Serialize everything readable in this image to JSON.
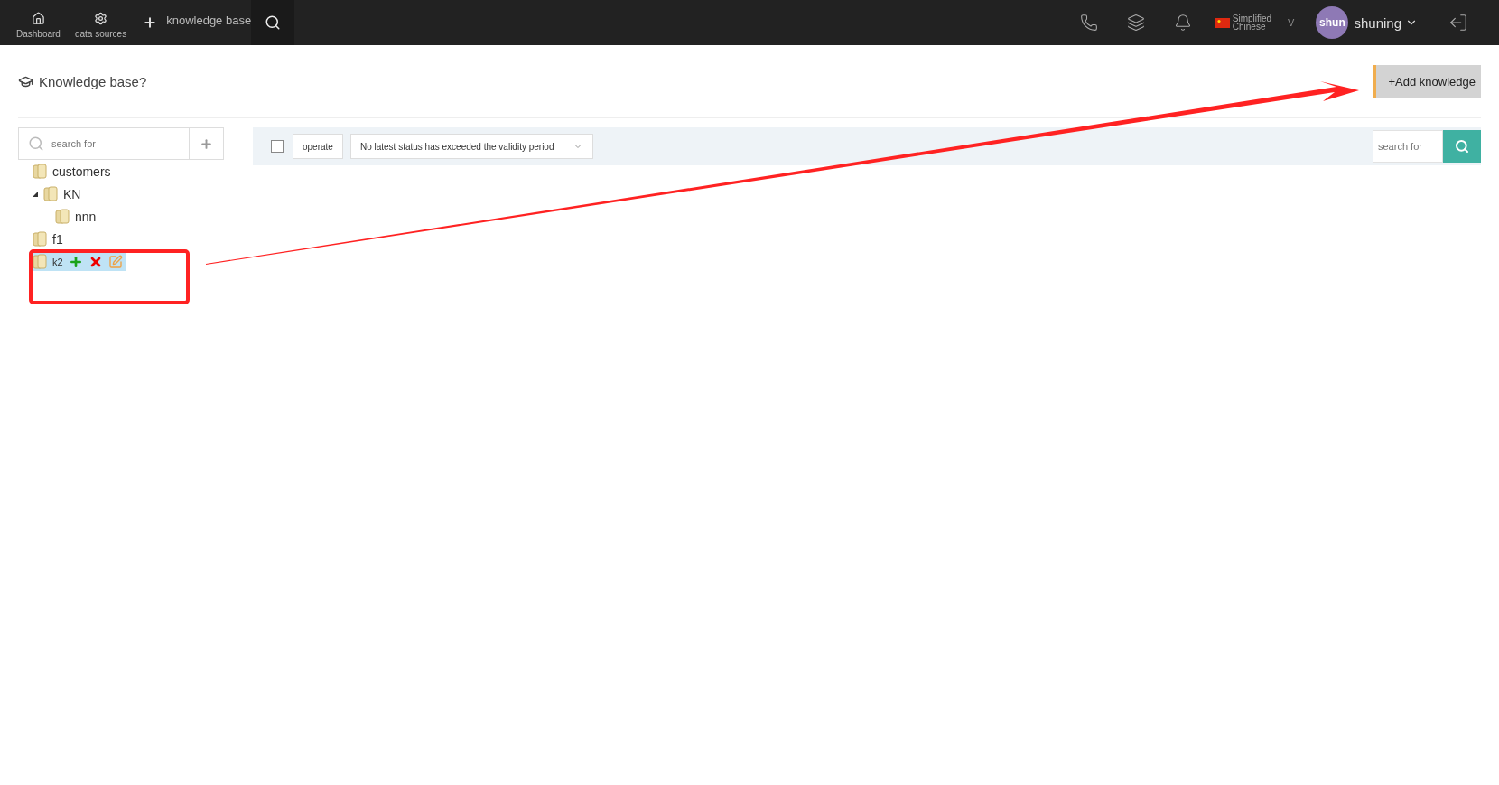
{
  "topbar": {
    "nav": [
      {
        "label": "Dashboard",
        "kind": "home"
      },
      {
        "label": "data sources",
        "kind": "gears"
      }
    ],
    "add_label": "knowledge base",
    "language": {
      "line1": "Simplified",
      "line2": "Chinese",
      "caret": "V"
    },
    "user": {
      "avatar": "shun",
      "name": "shuning"
    }
  },
  "page": {
    "title": "Knowledge base?",
    "add_button": "+Add knowledge"
  },
  "tree": {
    "search_placeholder": "search for",
    "items": [
      {
        "label": "customers",
        "selected": false,
        "expanded": false
      },
      {
        "label": "KN",
        "selected": false,
        "expanded": true,
        "children": [
          {
            "label": "nnn",
            "selected": false,
            "expanded": false
          }
        ]
      },
      {
        "label": "f1",
        "selected": false,
        "expanded": false
      },
      {
        "label": "k2",
        "selected": true,
        "expanded": false
      }
    ]
  },
  "filter": {
    "checked": false,
    "operate": "operate",
    "status": "No latest status has exceeded the validity period",
    "search_placeholder": "search for"
  }
}
